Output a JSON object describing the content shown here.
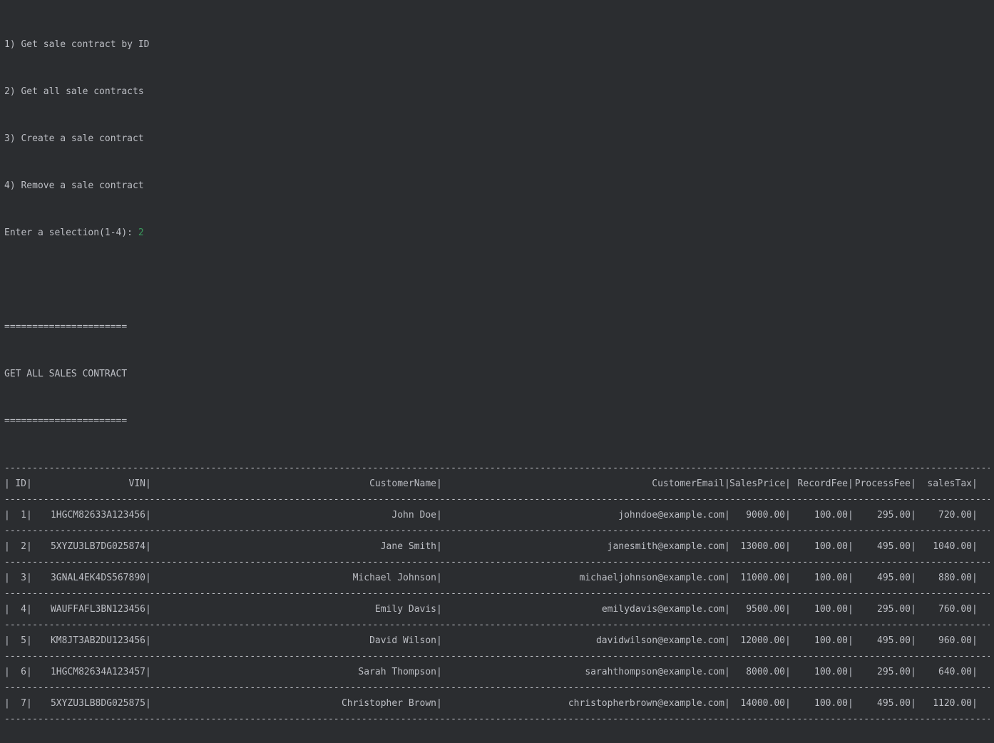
{
  "menu": {
    "items": [
      "1) Get sale contract by ID",
      "2) Get all sale contracts",
      "3) Create a sale contract",
      "4) Remove a sale contract"
    ],
    "prompt": "Enter a selection(1-4): ",
    "input_value": "2"
  },
  "banner": {
    "rule": "======================",
    "title": "GET ALL SALES CONTRACT"
  },
  "table": {
    "separator": "--------------------------------------------------------------------------------------------------------------------------------------------------------------------------------------------------------------",
    "columns": [
      "ID",
      "VIN",
      "CustomerName",
      "CustomerEmail",
      "SalesPrice",
      "RecordFee",
      "ProcessFee",
      "salesTax"
    ],
    "rows": [
      [
        "1",
        "1HGCM82633A123456",
        "John Doe",
        "johndoe@example.com",
        "9000.00",
        "100.00",
        "295.00",
        "720.00"
      ],
      [
        "2",
        "5XYZU3LB7DG025874",
        "Jane Smith",
        "janesmith@example.com",
        "13000.00",
        "100.00",
        "495.00",
        "1040.00"
      ],
      [
        "3",
        "3GNAL4EK4DS567890",
        "Michael Johnson",
        "michaeljohnson@example.com",
        "11000.00",
        "100.00",
        "495.00",
        "880.00"
      ],
      [
        "4",
        "WAUFFAFL3BN123456",
        "Emily Davis",
        "emilydavis@example.com",
        "9500.00",
        "100.00",
        "295.00",
        "760.00"
      ],
      [
        "5",
        "KM8JT3AB2DU123456",
        "David Wilson",
        "davidwilson@example.com",
        "12000.00",
        "100.00",
        "495.00",
        "960.00"
      ],
      [
        "6",
        "1HGCM82634A123457",
        "Sarah Thompson",
        "sarahthompson@example.com",
        "8000.00",
        "100.00",
        "295.00",
        "640.00"
      ],
      [
        "7",
        "5XYZU3LB8DG025875",
        "Christopher Brown",
        "christopherbrown@example.com",
        "14000.00",
        "100.00",
        "495.00",
        "1120.00"
      ]
    ]
  },
  "colors": {
    "background": "#2b2d30",
    "text": "#bcbec4",
    "input": "#3a9d5d"
  }
}
